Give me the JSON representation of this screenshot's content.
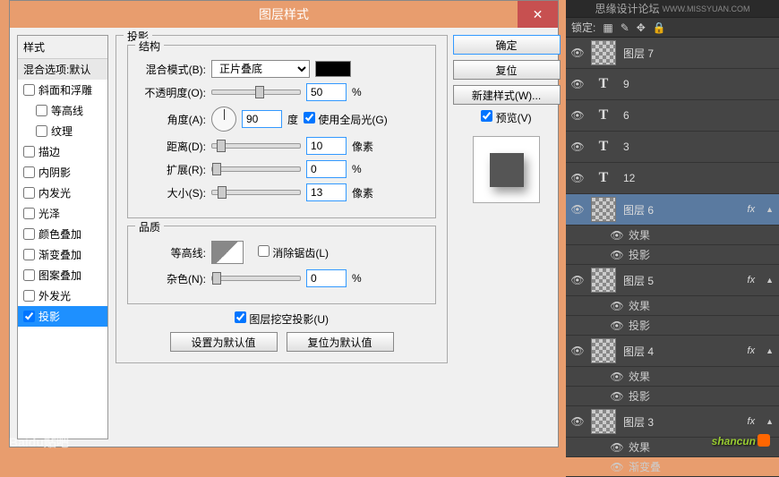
{
  "dialog": {
    "title": "图层样式",
    "section_title": "投影",
    "struct_title": "结构",
    "quality_title": "品质",
    "blend_mode_label": "混合模式(B):",
    "blend_mode_value": "正片叠底",
    "opacity_label": "不透明度(O):",
    "opacity_value": "50",
    "angle_label": "角度(A):",
    "angle_value": "90",
    "angle_unit": "度",
    "global_light": "使用全局光(G)",
    "distance_label": "距离(D):",
    "distance_value": "10",
    "spread_label": "扩展(R):",
    "spread_value": "0",
    "size_label": "大小(S):",
    "size_value": "13",
    "px_unit": "像素",
    "pct_unit": "%",
    "contour_label": "等高线:",
    "antialias": "消除锯齿(L)",
    "noise_label": "杂色(N):",
    "noise_value": "0",
    "knockout": "图层挖空投影(U)",
    "set_default": "设置为默认值",
    "reset_default": "复位为默认值"
  },
  "styleList": {
    "header": "样式",
    "blend": "混合选项:默认",
    "items": [
      "斜面和浮雕",
      "等高线",
      "纹理",
      "描边",
      "内阴影",
      "内发光",
      "光泽",
      "颜色叠加",
      "渐变叠加",
      "图案叠加",
      "外发光",
      "投影"
    ]
  },
  "buttons": {
    "ok": "确定",
    "reset": "复位",
    "new_style": "新建样式(W)...",
    "preview": "预览(V)"
  },
  "layersHeader": {
    "lock_label": "锁定:",
    "title": "思缘设计论坛",
    "url": "WWW.MISSYUAN.COM"
  },
  "layers": [
    {
      "type": "layer",
      "name": "图层 7"
    },
    {
      "type": "text",
      "name": "9"
    },
    {
      "type": "text",
      "name": "6"
    },
    {
      "type": "text",
      "name": "3"
    },
    {
      "type": "text",
      "name": "12"
    },
    {
      "type": "layer",
      "name": "图层 6",
      "selected": true,
      "fx": true,
      "subs": [
        "效果",
        "投影"
      ]
    },
    {
      "type": "layer",
      "name": "图层 5",
      "fx": true,
      "subs": [
        "效果",
        "投影"
      ]
    },
    {
      "type": "layer",
      "name": "图层 4",
      "fx": true,
      "subs": [
        "效果",
        "投影"
      ]
    },
    {
      "type": "layer",
      "name": "图层 3",
      "fx": true,
      "subs": [
        "效果",
        "渐变叠"
      ]
    }
  ],
  "sub_eye": "●",
  "watermark": "Baidu贴吧",
  "shancun": "shancun"
}
